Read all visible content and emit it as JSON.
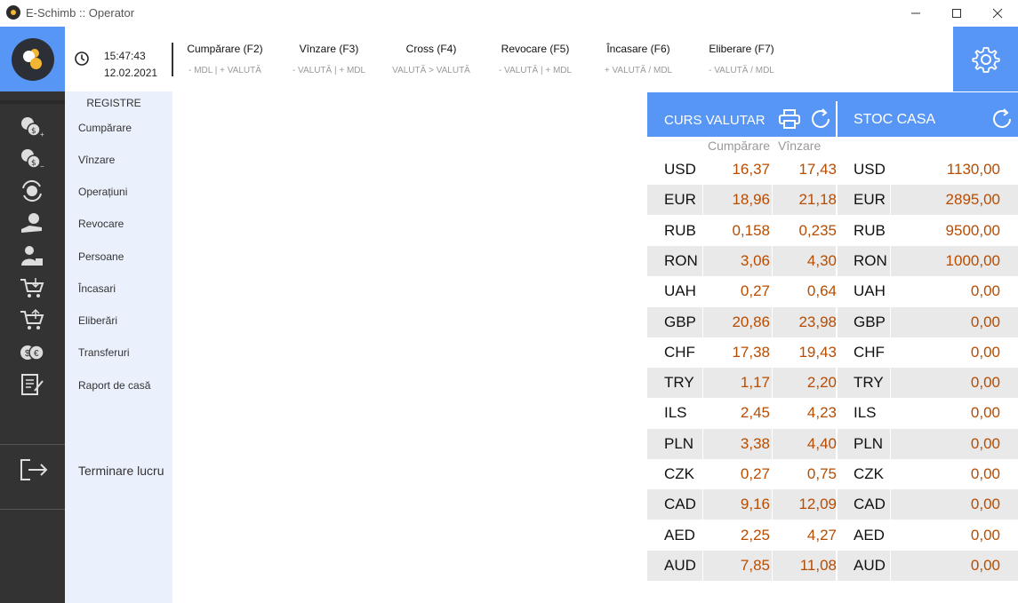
{
  "window": {
    "title": "E-Schimb :: Operator"
  },
  "header": {
    "time": "15:47:43",
    "date": "12.02.2021",
    "operations": [
      {
        "label": "Cumpărare (F2)",
        "sub": "- MDL | + VALUTĂ"
      },
      {
        "label": "Vînzare (F3)",
        "sub": "- VALUTĂ | + MDL"
      },
      {
        "label": "Cross (F4)",
        "sub": "VALUTĂ > VALUTĂ"
      },
      {
        "label": "Revocare (F5)",
        "sub": "- VALUTĂ | + MDL"
      },
      {
        "label": "Încasare (F6)",
        "sub": "+ VALUTĂ / MDL"
      },
      {
        "label": "Eliberare (F7)",
        "sub": "- VALUTĂ / MDL"
      }
    ]
  },
  "sidebar": {
    "heading": "REGISTRE",
    "items": [
      {
        "label": "Cumpărare",
        "icon": "buy-currency-icon"
      },
      {
        "label": "Vînzare",
        "icon": "sell-currency-icon"
      },
      {
        "label": "Operațiuni",
        "icon": "operations-icon"
      },
      {
        "label": "Revocare",
        "icon": "revoke-icon"
      },
      {
        "label": "Persoane",
        "icon": "persons-icon"
      },
      {
        "label": "Încasari",
        "icon": "receipts-cart-icon"
      },
      {
        "label": "Eliberări",
        "icon": "release-cart-icon"
      },
      {
        "label": "Transferuri",
        "icon": "transfers-icon"
      },
      {
        "label": "Raport de casă",
        "icon": "cash-report-icon"
      }
    ],
    "exit_label": "Terminare lucru"
  },
  "rates": {
    "title": "CURS VALUTAR",
    "buy_caption": "Cumpărare",
    "sell_caption": "Vînzare",
    "rows": [
      {
        "code": "USD",
        "buy": "16,37",
        "sell": "17,43"
      },
      {
        "code": "EUR",
        "buy": "18,96",
        "sell": "21,18"
      },
      {
        "code": "RUB",
        "buy": "0,158",
        "sell": "0,235"
      },
      {
        "code": "RON",
        "buy": "3,06",
        "sell": "4,30"
      },
      {
        "code": "UAH",
        "buy": "0,27",
        "sell": "0,64"
      },
      {
        "code": "GBP",
        "buy": "20,86",
        "sell": "23,98"
      },
      {
        "code": "CHF",
        "buy": "17,38",
        "sell": "19,43"
      },
      {
        "code": "TRY",
        "buy": "1,17",
        "sell": "2,20"
      },
      {
        "code": "ILS",
        "buy": "2,45",
        "sell": "4,23"
      },
      {
        "code": "PLN",
        "buy": "3,38",
        "sell": "4,40"
      },
      {
        "code": "CZK",
        "buy": "0,27",
        "sell": "0,75"
      },
      {
        "code": "CAD",
        "buy": "9,16",
        "sell": "12,09"
      },
      {
        "code": "AED",
        "buy": "2,25",
        "sell": "4,27"
      },
      {
        "code": "AUD",
        "buy": "7,85",
        "sell": "11,08"
      }
    ]
  },
  "stock": {
    "title": "STOC CASA",
    "rows": [
      {
        "code": "USD",
        "amount": "1130,00"
      },
      {
        "code": "EUR",
        "amount": "2895,00"
      },
      {
        "code": "RUB",
        "amount": "9500,00"
      },
      {
        "code": "RON",
        "amount": "1000,00"
      },
      {
        "code": "UAH",
        "amount": "0,00"
      },
      {
        "code": "GBP",
        "amount": "0,00"
      },
      {
        "code": "CHF",
        "amount": "0,00"
      },
      {
        "code": "TRY",
        "amount": "0,00"
      },
      {
        "code": "ILS",
        "amount": "0,00"
      },
      {
        "code": "PLN",
        "amount": "0,00"
      },
      {
        "code": "CZK",
        "amount": "0,00"
      },
      {
        "code": "CAD",
        "amount": "0,00"
      },
      {
        "code": "AED",
        "amount": "0,00"
      },
      {
        "code": "AUD",
        "amount": "0,00"
      }
    ]
  },
  "colors": {
    "accent": "#5896f5",
    "rail": "#333333",
    "subnav": "#eaf0fc",
    "value": "#b84c00",
    "row_alt": "#e9e9e9"
  }
}
